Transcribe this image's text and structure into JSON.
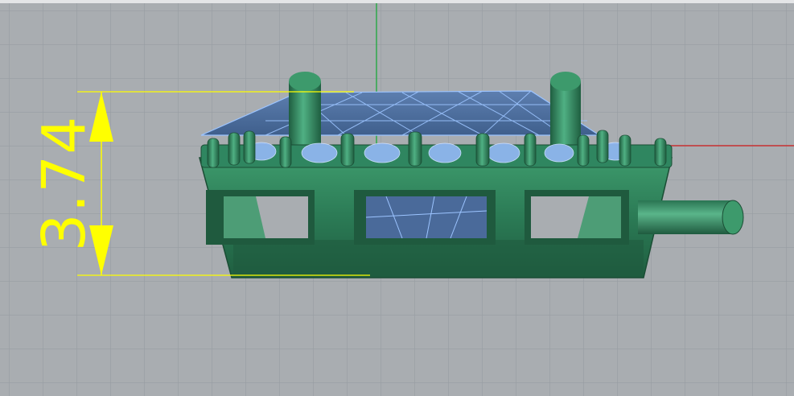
{
  "viewport": {
    "dimension_value": "3.74",
    "colors": {
      "background": "#a9adb1",
      "grid": "#969ba0",
      "dimension": "#ffff00",
      "model": "#2e7d5a",
      "gem": "#7fa8e0",
      "x_axis": "#c83232",
      "y_axis": "#2fa84a"
    }
  }
}
